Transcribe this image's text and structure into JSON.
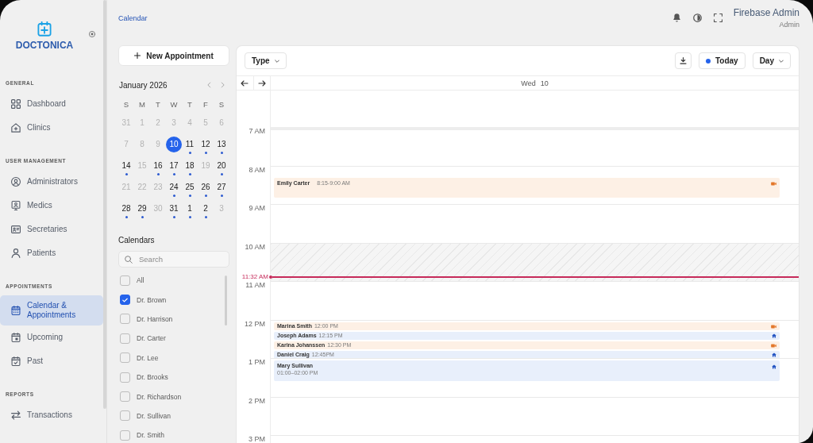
{
  "sidebar": {
    "logo": "DOCTONICA",
    "sections": [
      {
        "title": "GENERAL",
        "items": [
          {
            "label": "Dashboard",
            "selected": false
          },
          {
            "label": "Clinics",
            "selected": false
          }
        ]
      },
      {
        "title": "USER MANAGEMENT",
        "items": [
          {
            "label": "Administrators",
            "selected": false
          },
          {
            "label": "Medics",
            "selected": false
          },
          {
            "label": "Secretaries",
            "selected": false
          },
          {
            "label": "Patients",
            "selected": false
          }
        ]
      },
      {
        "title": "APPOINTMENTS",
        "items": [
          {
            "label": "Calendar & Appointments",
            "selected": true
          },
          {
            "label": "Upcoming",
            "selected": false
          },
          {
            "label": "Past",
            "selected": false
          }
        ]
      },
      {
        "title": "REPORTS",
        "items": [
          {
            "label": "Transactions",
            "selected": false
          }
        ]
      }
    ]
  },
  "topbar": {
    "breadcrumb": "Calendar",
    "user": {
      "name": "Firebase Admin",
      "role": "Admin"
    }
  },
  "left_panel": {
    "new_appointment_button": "New Appointment",
    "mini_calendar": {
      "month": "January 2026",
      "weekdays": [
        "S",
        "M",
        "T",
        "W",
        "T",
        "F",
        "S"
      ],
      "weeks": [
        [
          {
            "label": "31",
            "muted": true,
            "selected": false,
            "has_events": false
          },
          {
            "label": "1",
            "muted": true,
            "selected": false,
            "has_events": false
          },
          {
            "label": "2",
            "muted": true,
            "selected": false,
            "has_events": false
          },
          {
            "label": "3",
            "muted": true,
            "selected": false,
            "has_events": false
          },
          {
            "label": "4",
            "muted": true,
            "selected": false,
            "has_events": false
          },
          {
            "label": "5",
            "muted": true,
            "selected": false,
            "has_events": false
          },
          {
            "label": "6",
            "muted": true,
            "selected": false,
            "has_events": false
          }
        ],
        [
          {
            "label": "7",
            "muted": true,
            "selected": false,
            "has_events": false
          },
          {
            "label": "8",
            "muted": true,
            "selected": false,
            "has_events": false
          },
          {
            "label": "9",
            "muted": true,
            "selected": false,
            "has_events": false
          },
          {
            "label": "10",
            "muted": false,
            "selected": true,
            "has_events": false
          },
          {
            "label": "11",
            "muted": false,
            "selected": false,
            "has_events": true
          },
          {
            "label": "12",
            "muted": false,
            "selected": false,
            "has_events": true
          },
          {
            "label": "13",
            "muted": false,
            "selected": false,
            "has_events": true
          }
        ],
        [
          {
            "label": "14",
            "muted": false,
            "selected": false,
            "has_events": true
          },
          {
            "label": "15",
            "muted": true,
            "selected": false,
            "has_events": false
          },
          {
            "label": "16",
            "muted": false,
            "selected": false,
            "has_events": true
          },
          {
            "label": "17",
            "muted": false,
            "selected": false,
            "has_events": true
          },
          {
            "label": "18",
            "muted": false,
            "selected": false,
            "has_events": true
          },
          {
            "label": "19",
            "muted": true,
            "selected": false,
            "has_events": false
          },
          {
            "label": "20",
            "muted": false,
            "selected": false,
            "has_events": true
          }
        ],
        [
          {
            "label": "21",
            "muted": true,
            "selected": false,
            "has_events": false
          },
          {
            "label": "22",
            "muted": true,
            "selected": false,
            "has_events": false
          },
          {
            "label": "23",
            "muted": true,
            "selected": false,
            "has_events": false
          },
          {
            "label": "24",
            "muted": false,
            "selected": false,
            "has_events": true
          },
          {
            "label": "25",
            "muted": false,
            "selected": false,
            "has_events": true
          },
          {
            "label": "26",
            "muted": false,
            "selected": false,
            "has_events": true
          },
          {
            "label": "27",
            "muted": false,
            "selected": false,
            "has_events": true
          }
        ],
        [
          {
            "label": "28",
            "muted": false,
            "selected": false,
            "has_events": true
          },
          {
            "label": "29",
            "muted": false,
            "selected": false,
            "has_events": true
          },
          {
            "label": "30",
            "muted": true,
            "selected": false,
            "has_events": false
          },
          {
            "label": "31",
            "muted": false,
            "selected": false,
            "has_events": true
          },
          {
            "label": "1",
            "muted": false,
            "selected": false,
            "has_events": true
          },
          {
            "label": "2",
            "muted": false,
            "selected": false,
            "has_events": true
          },
          {
            "label": "3",
            "muted": true,
            "selected": false,
            "has_events": false
          }
        ]
      ]
    },
    "calendars": {
      "title": "Calendars",
      "search": {
        "placeholder": "Search"
      },
      "items": [
        {
          "label": "All",
          "checked": false
        },
        {
          "label": "Dr. Brown",
          "checked": true
        },
        {
          "label": "Dr. Harrison",
          "checked": false
        },
        {
          "label": "Dr. Carter",
          "checked": false
        },
        {
          "label": "Dr. Lee",
          "checked": false
        },
        {
          "label": "Dr. Brooks",
          "checked": false
        },
        {
          "label": "Dr. Richardson",
          "checked": false
        },
        {
          "label": "Dr. Sullivan",
          "checked": false
        },
        {
          "label": "Dr. Smith",
          "checked": false
        }
      ]
    }
  },
  "day_view": {
    "toolbar": {
      "type_filter": "Type",
      "today_button": "Today",
      "view_select": "Day"
    },
    "header": {
      "weekday": "Wed",
      "date": "10"
    },
    "current_time": "11:32 AM",
    "hours": [
      {
        "label": "7 AM",
        "unavailable": false
      },
      {
        "label": "8 AM",
        "unavailable": false,
        "events": [
          {
            "name": "Emily Carter",
            "time": "8:15-9:00 AM",
            "video_call": true,
            "kind": "wide"
          }
        ]
      },
      {
        "label": "9 AM",
        "unavailable": false
      },
      {
        "label": "10 AM",
        "unavailable": true
      },
      {
        "label": "11 AM",
        "unavailable": false
      },
      {
        "label": "12 PM",
        "unavailable": false,
        "events": [
          {
            "name": "Marina Smith",
            "time": "12:00 PM",
            "video_call": true,
            "kind": "compact"
          },
          {
            "name": "Joseph Adams",
            "time": "12:15 PM",
            "video_call": false,
            "kind": "compact"
          },
          {
            "name": "Karina Johanssen",
            "time": "12:30 PM",
            "video_call": true,
            "kind": "compact"
          },
          {
            "name": "Daniel Craig",
            "time": "12:45PM",
            "video_call": false,
            "kind": "compact"
          }
        ]
      },
      {
        "label": "1 PM",
        "unavailable": false,
        "events": [
          {
            "name": "Mary Sullivan",
            "time": "01:00–02:00 PM",
            "video_call": false,
            "kind": "stacked"
          }
        ]
      },
      {
        "label": "2 PM",
        "unavailable": false
      },
      {
        "label": "3 PM",
        "unavailable": false
      }
    ]
  }
}
